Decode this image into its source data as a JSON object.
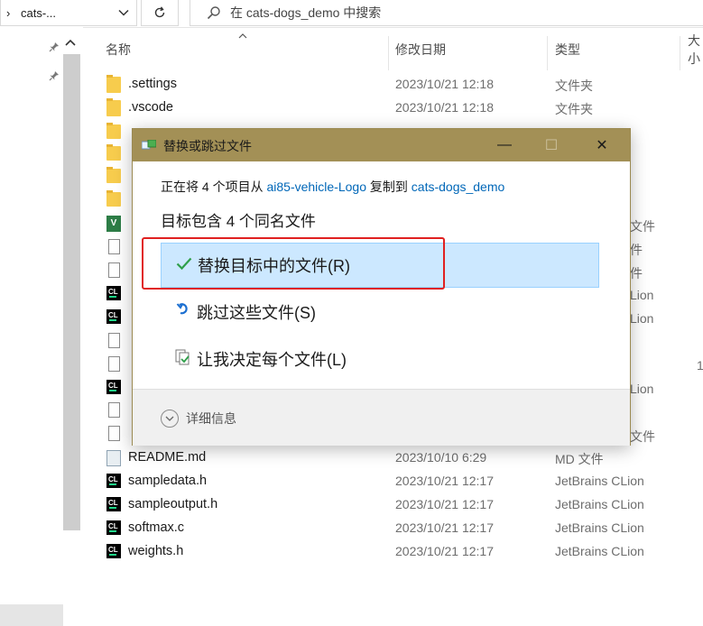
{
  "address": {
    "breadcrumb_chevron": "›",
    "current": "cats-...",
    "dropdown_icon": "chevron-down-icon",
    "refresh_icon": "refresh-icon"
  },
  "search": {
    "placeholder": "在 cats-dogs_demo 中搜索",
    "icon": "search-icon"
  },
  "columns": {
    "name": "名称",
    "date": "修改日期",
    "type": "类型",
    "size": "大小"
  },
  "files": [
    {
      "name": ".settings",
      "date": "2023/10/21 12:18",
      "type": "文件夹",
      "icon": "folder-icon"
    },
    {
      "name": ".vscode",
      "date": "2023/10/21 12:18",
      "type": "文件夹",
      "icon": "folder-icon"
    },
    {
      "name": "README.md",
      "date": "2023/10/10 6:29",
      "type": "MD 文件",
      "icon": "markdown-file-icon"
    },
    {
      "name": "sampledata.h",
      "date": "2023/10/21 12:17",
      "type": "JetBrains CLion",
      "icon": "clion-file-icon"
    },
    {
      "name": "sampleoutput.h",
      "date": "2023/10/21 12:17",
      "type": "JetBrains CLion",
      "icon": "clion-file-icon"
    },
    {
      "name": "softmax.c",
      "date": "2023/10/21 12:17",
      "type": "JetBrains CLion",
      "icon": "clion-file-icon"
    },
    {
      "name": "weights.h",
      "date": "2023/10/21 12:17",
      "type": "JetBrains CLion",
      "icon": "clion-file-icon"
    }
  ],
  "partial_types": [
    "文件",
    "件",
    "件",
    "Lion",
    "Lion",
    "Lion",
    "文件"
  ],
  "partial_size": "1",
  "dialog": {
    "title": "替换或跳过文件",
    "minimize": "—",
    "maximize": "☐",
    "close": "✕",
    "copy_prefix": "正在将 4 个项目从 ",
    "source": "ai85-vehicle-Logo",
    "copy_middle": " 复制到 ",
    "destination": "cats-dogs_demo",
    "headline": "目标包含 4 个同名文件",
    "options": [
      {
        "label": "替换目标中的文件(R)",
        "icon": "checkmark-icon",
        "selected": true
      },
      {
        "label": "跳过这些文件(S)",
        "icon": "skip-icon",
        "selected": false
      },
      {
        "label": "让我决定每个文件(L)",
        "icon": "decide-icon",
        "selected": false
      }
    ],
    "details": "详细信息",
    "details_icon": "chevron-down-circle-icon"
  },
  "colors": {
    "title_bar": "#a39056",
    "selection": "#cce8ff",
    "link": "#0067b8",
    "highlight_box": "#e02020",
    "check": "#2e9f4a"
  }
}
